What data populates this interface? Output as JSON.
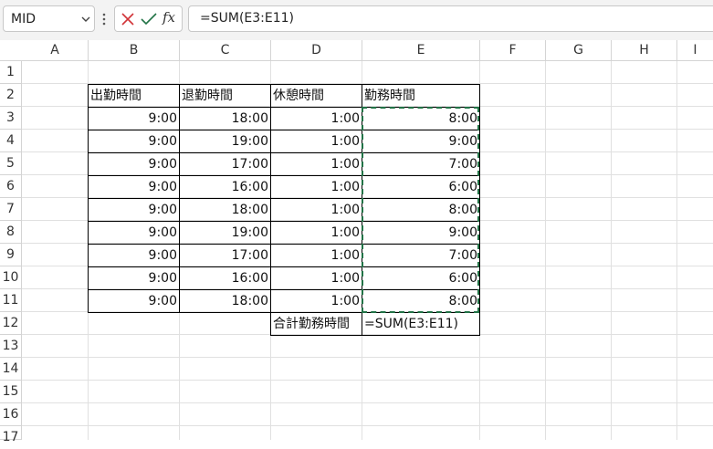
{
  "namebox": {
    "value": "MID"
  },
  "formula_bar": {
    "value": "=SUM(E3:E11)",
    "fx_label": "fx"
  },
  "columns": [
    "A",
    "B",
    "C",
    "D",
    "E",
    "F",
    "G",
    "H",
    "I"
  ],
  "rows": [
    "1",
    "2",
    "3",
    "4",
    "5",
    "6",
    "7",
    "8",
    "9",
    "10",
    "11",
    "12",
    "13",
    "14",
    "15",
    "16",
    "17"
  ],
  "table": {
    "headers": [
      "出勤時間",
      "退勤時間",
      "休憩時間",
      "勤務時間"
    ],
    "rows": [
      [
        "9:00",
        "18:00",
        "1:00",
        "8:00"
      ],
      [
        "9:00",
        "19:00",
        "1:00",
        "9:00"
      ],
      [
        "9:00",
        "17:00",
        "1:00",
        "7:00"
      ],
      [
        "9:00",
        "16:00",
        "1:00",
        "6:00"
      ],
      [
        "9:00",
        "18:00",
        "1:00",
        "8:00"
      ],
      [
        "9:00",
        "19:00",
        "1:00",
        "9:00"
      ],
      [
        "9:00",
        "17:00",
        "1:00",
        "7:00"
      ],
      [
        "9:00",
        "16:00",
        "1:00",
        "6:00"
      ],
      [
        "9:00",
        "18:00",
        "1:00",
        "8:00"
      ]
    ],
    "total_label": "合計勤務時間",
    "total_formula": "=SUM(E3:E11)"
  },
  "colors": {
    "marquee": "#217346",
    "cancel": "#d13438",
    "enter": "#217346"
  }
}
